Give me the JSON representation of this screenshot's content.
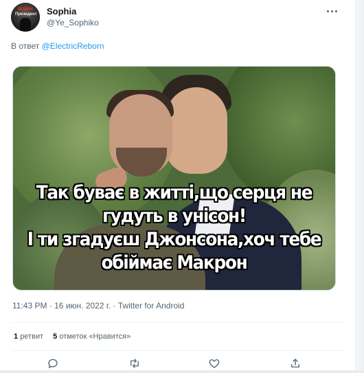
{
  "tweet": {
    "author_name": "Sophia",
    "author_handle": "@Ye_Sophiko",
    "avatar_text_line1": "ВОВАН",
    "avatar_text_line2": "Президент",
    "reply_prefix": "В ответ",
    "reply_mention": "@ElectricReborn",
    "image_caption": {
      "line1": "Так буває в житті,що серця не",
      "line2": "гудуть в унісон!",
      "line3": "І ти згадуєш Джонсона,хоч тебе",
      "line4": "обіймає Макрон"
    },
    "timestamp": "11:43 PM · 16 июн. 2022 г. · Twitter for Android",
    "retweet_count": "1",
    "retweet_label": "ретвит",
    "like_count": "5",
    "like_label": "отметок «Нравится»"
  },
  "actions": {
    "reply_icon": "comment-icon",
    "retweet_icon": "retweet-icon",
    "like_icon": "heart-icon",
    "share_icon": "share-icon"
  },
  "colors": {
    "text_primary": "#0f1419",
    "text_secondary": "#536471",
    "link": "#1d9bf0",
    "divider": "#eff3f4"
  }
}
